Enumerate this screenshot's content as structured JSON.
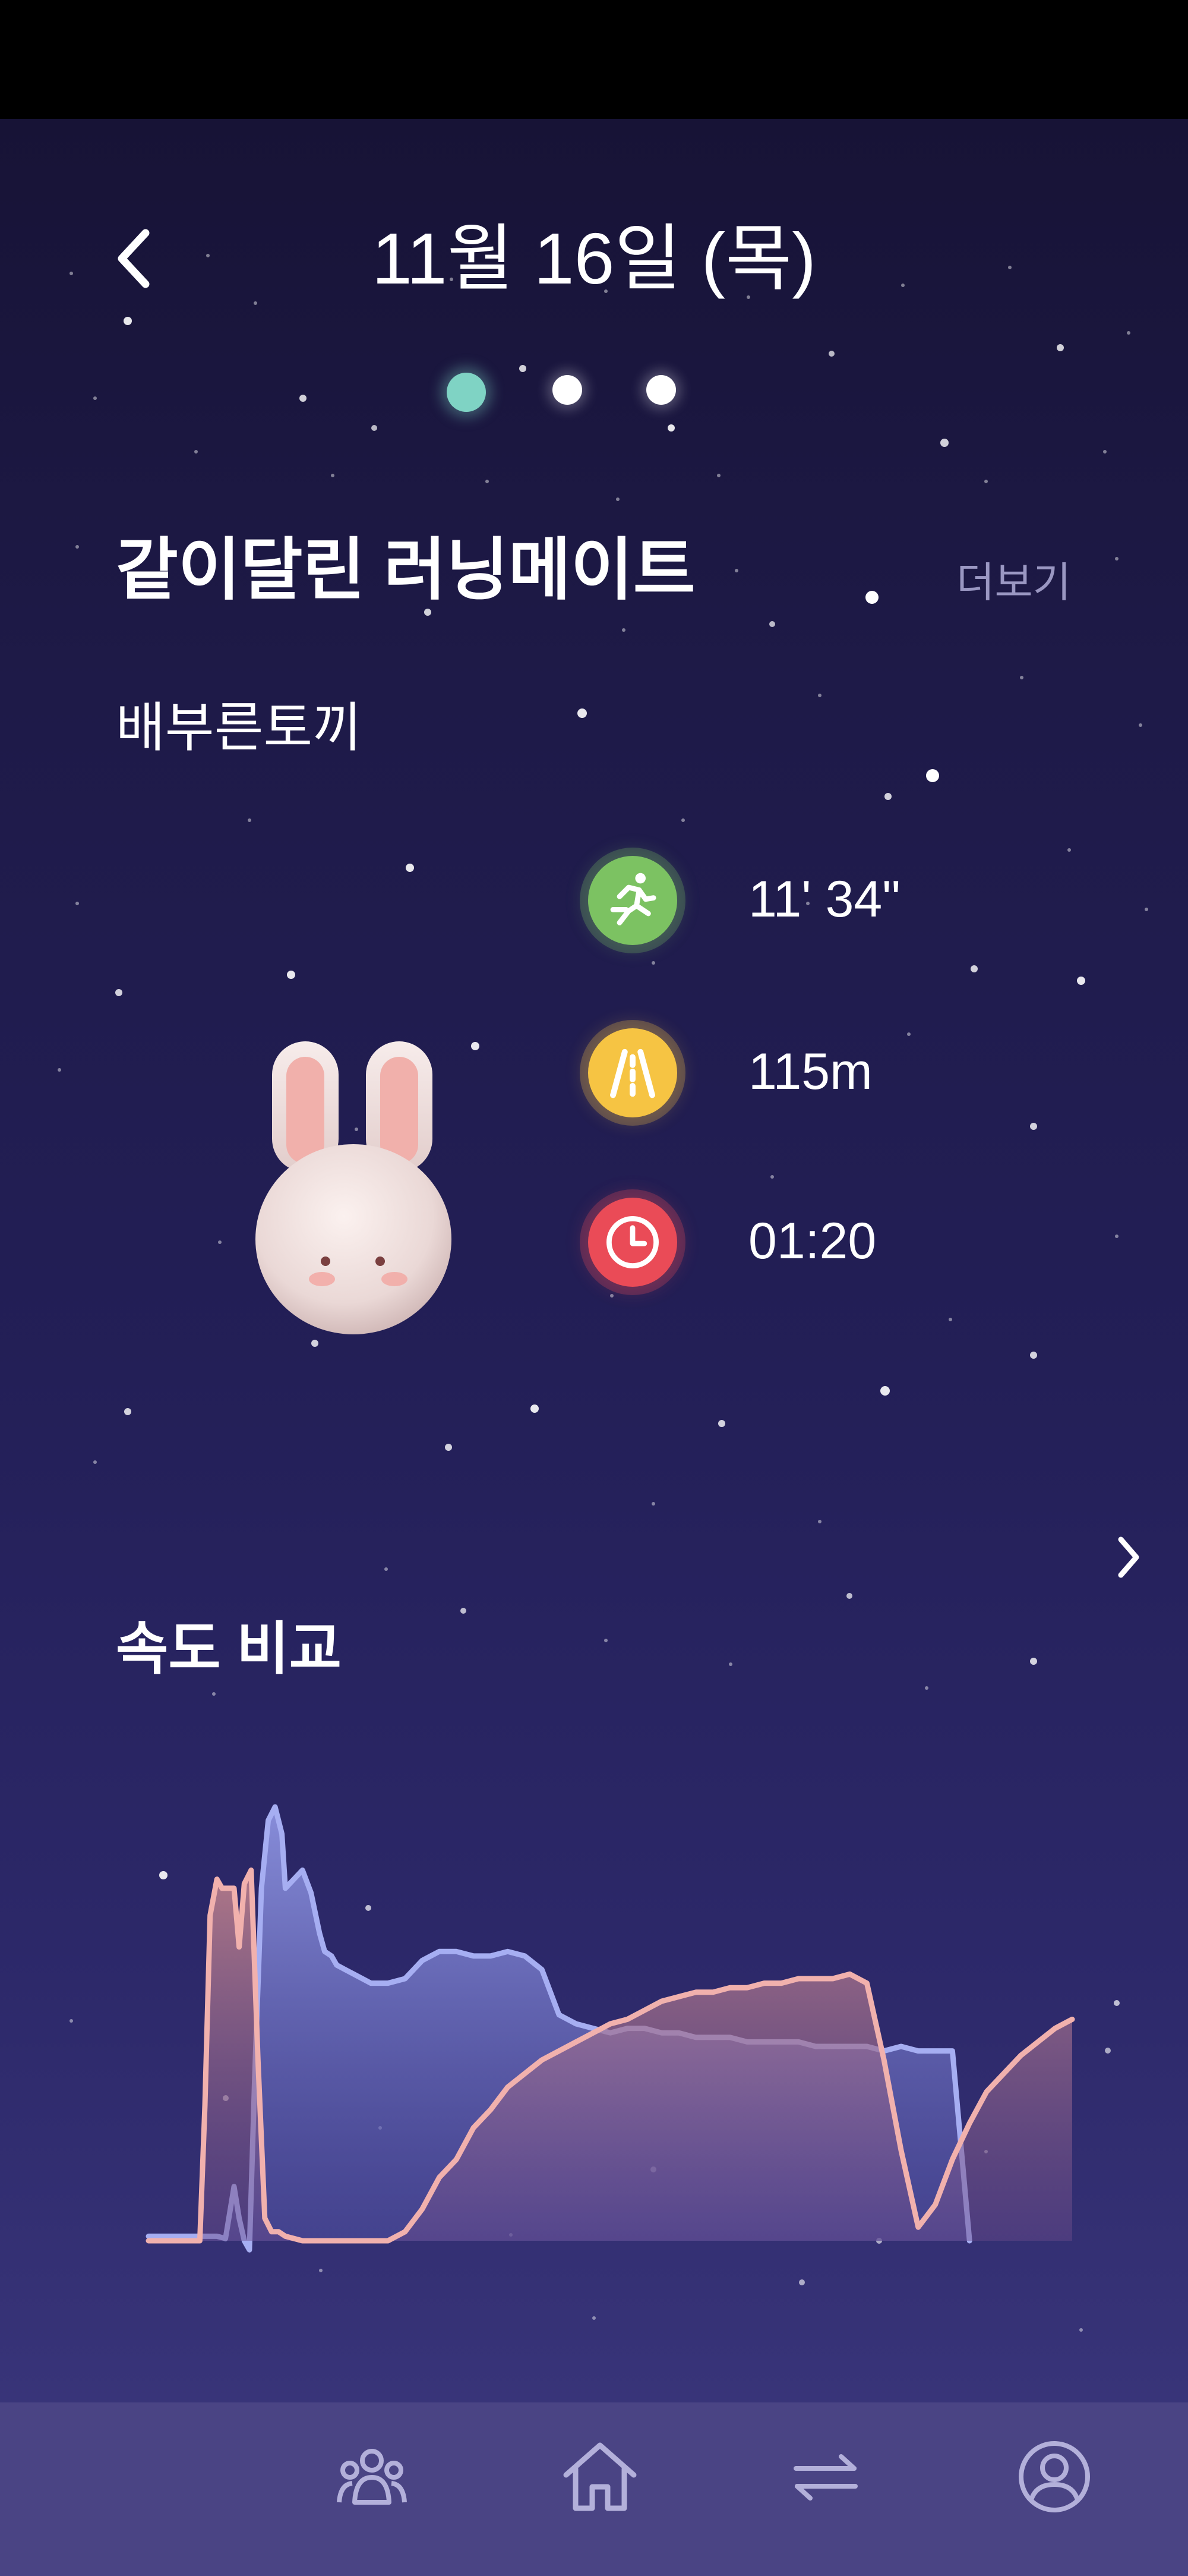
{
  "header": {
    "title": "11월 16일 (목)",
    "page_indicator": {
      "count": 3,
      "active_index": 0
    }
  },
  "runningmate": {
    "section_title": "같이달린 러닝메이트",
    "more_label": "더보기",
    "mate_name": "배부른토끼",
    "stats": [
      {
        "icon": "running-person-icon",
        "value": "11' 34\"",
        "color": "#7cc262"
      },
      {
        "icon": "road-icon",
        "value": "115m",
        "color": "#f6c443"
      },
      {
        "icon": "clock-icon",
        "value": "01:20",
        "color": "#ea4b57"
      }
    ]
  },
  "speed": {
    "section_title": "속도 비교"
  },
  "chart_data": {
    "type": "area",
    "title": "속도 비교",
    "xlabel": "",
    "ylabel": "",
    "grid": false,
    "series": [
      {
        "name": "",
        "color": "#a6aef2",
        "x": [
          0,
          2,
          4,
          4.5,
          5,
          5.3,
          5.6,
          5.9,
          6.2,
          6.6,
          7,
          7.4,
          7.8,
          8,
          8.5,
          9,
          9.5,
          10,
          10.3,
          10.7,
          11,
          11.5,
          12,
          12.5,
          13,
          14,
          15,
          16,
          16.5,
          17,
          18,
          19,
          20,
          21,
          22,
          23,
          24,
          25,
          26,
          27,
          28,
          29,
          30,
          31,
          32,
          33,
          34,
          35,
          36,
          37,
          38,
          39,
          40,
          41,
          42,
          43,
          44,
          45,
          46,
          47,
          48,
          49,
          50,
          51,
          52
        ],
        "values": [
          0.01,
          0.01,
          0.01,
          0.005,
          0.12,
          0.05,
          0.0,
          -0.02,
          0.35,
          0.78,
          0.93,
          0.96,
          0.9,
          0.78,
          0.8,
          0.82,
          0.77,
          0.68,
          0.64,
          0.63,
          0.61,
          0.6,
          0.59,
          0.58,
          0.57,
          0.57,
          0.58,
          0.62,
          0.63,
          0.64,
          0.64,
          0.63,
          0.63,
          0.64,
          0.63,
          0.6,
          0.5,
          0.48,
          0.47,
          0.46,
          0.47,
          0.47,
          0.46,
          0.46,
          0.45,
          0.45,
          0.45,
          0.44,
          0.44,
          0.44,
          0.44,
          0.43,
          0.43,
          0.43,
          0.43,
          0.42,
          0.43,
          0.42,
          0.42,
          0.42,
          0.0,
          null,
          null,
          null,
          null
        ]
      },
      {
        "name": "",
        "color": "#f1b1ad",
        "x": [
          0,
          2,
          3,
          3.3,
          3.6,
          4,
          4.3,
          4.6,
          5,
          5.3,
          5.6,
          6,
          6.4,
          6.8,
          7.2,
          7.6,
          8,
          9,
          10,
          11,
          12,
          13,
          14,
          15,
          16,
          17,
          18,
          19,
          20,
          21,
          22,
          23,
          24,
          25,
          26,
          27,
          28,
          29,
          30,
          31,
          32,
          33,
          34,
          35,
          36,
          37,
          38,
          39,
          40,
          41,
          42,
          43,
          44,
          45,
          46,
          47,
          48,
          49,
          50,
          51,
          52,
          53,
          54
        ],
        "values": [
          0.0,
          0.0,
          0.0,
          0.3,
          0.72,
          0.8,
          0.78,
          0.78,
          0.78,
          0.65,
          0.79,
          0.82,
          0.4,
          0.05,
          0.02,
          0.02,
          0.01,
          0.0,
          0.0,
          0.0,
          0.0,
          0.0,
          0.0,
          0.02,
          0.07,
          0.14,
          0.18,
          0.25,
          0.29,
          0.34,
          0.37,
          0.4,
          0.42,
          0.44,
          0.46,
          0.48,
          0.49,
          0.51,
          0.53,
          0.54,
          0.55,
          0.55,
          0.56,
          0.56,
          0.57,
          0.57,
          0.58,
          0.58,
          0.58,
          0.59,
          0.57,
          0.4,
          0.2,
          0.03,
          0.08,
          0.18,
          0.26,
          0.33,
          0.37,
          0.41,
          0.44,
          0.47,
          0.49
        ]
      }
    ]
  },
  "bottom_nav": {
    "items": [
      {
        "name": "nav-stats",
        "icon": "bar-chart-icon"
      },
      {
        "name": "nav-crew",
        "icon": "group-icon"
      },
      {
        "name": "nav-home",
        "icon": "home-icon"
      },
      {
        "name": "nav-exchange",
        "icon": "swap-icon"
      },
      {
        "name": "nav-profile",
        "icon": "user-icon"
      }
    ]
  },
  "colors": {
    "background_top": "#171336",
    "background_bottom": "#383479",
    "nav_background": "#4a4484",
    "active_dot": "#7fd3c4",
    "muted_text": "#9a97c2"
  }
}
